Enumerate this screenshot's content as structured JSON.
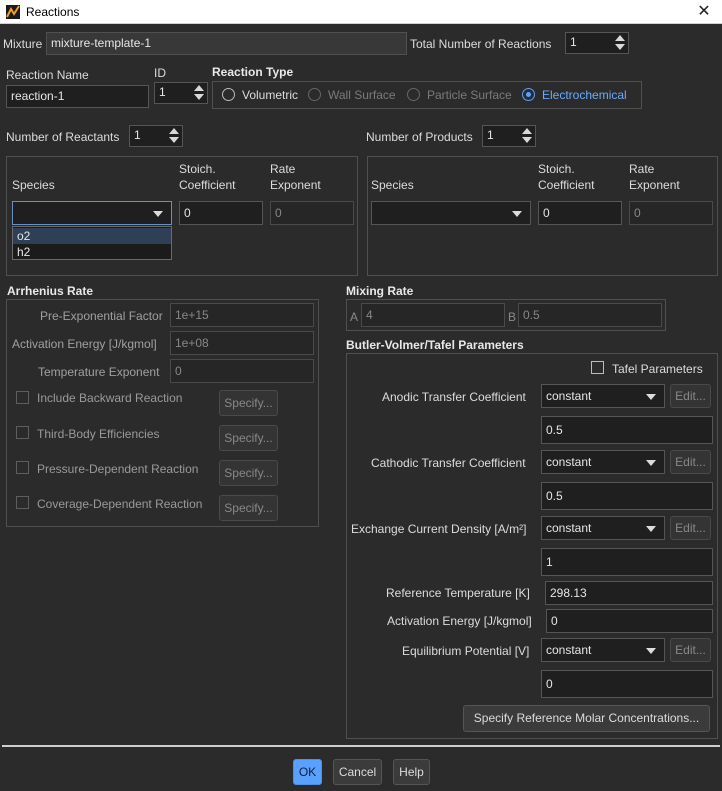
{
  "window": {
    "title": "Reactions",
    "close_glyph": "✕"
  },
  "mixture": {
    "label": "Mixture",
    "value": "mixture-template-1",
    "total_label": "Total Number of Reactions",
    "total_value": "1"
  },
  "reaction": {
    "name_label": "Reaction Name",
    "name_value": "reaction-1",
    "id_label": "ID",
    "id_value": "1",
    "type_label": "Reaction Type",
    "types": [
      "Volumetric",
      "Wall Surface",
      "Particle Surface",
      "Electrochemical"
    ],
    "selected_type": "Electrochemical"
  },
  "reactants": {
    "count_label": "Number of Reactants",
    "count_value": "1",
    "species_label": "Species",
    "stoich_label_1": "Stoich.",
    "stoich_label_2": "Coefficient",
    "rate_label_1": "Rate",
    "rate_label_2": "Exponent",
    "species_value": "",
    "stoich_value": "0",
    "rate_value": "0",
    "dropdown_options": [
      "o2",
      "h2"
    ]
  },
  "products": {
    "count_label": "Number of Products",
    "count_value": "1",
    "species_label": "Species",
    "stoich_label_1": "Stoich.",
    "stoich_label_2": "Coefficient",
    "rate_label_1": "Rate",
    "rate_label_2": "Exponent",
    "species_value": "",
    "stoich_value": "0",
    "rate_value": "0"
  },
  "arrhenius": {
    "title": "Arrhenius Rate",
    "pre_exp_label": "Pre-Exponential Factor",
    "pre_exp_value": "1e+15",
    "act_energy_label": "Activation Energy [J/kgmol]",
    "act_energy_value": "1e+08",
    "temp_exp_label": "Temperature Exponent",
    "temp_exp_value": "0",
    "options": [
      {
        "label": "Include Backward Reaction",
        "button": "Specify..."
      },
      {
        "label": "Third-Body Efficiencies",
        "button": "Specify..."
      },
      {
        "label": "Pressure-Dependent Reaction",
        "button": "Specify..."
      },
      {
        "label": "Coverage-Dependent Reaction",
        "button": "Specify..."
      }
    ]
  },
  "mixing": {
    "title": "Mixing Rate",
    "a_label": "A",
    "a_value": "4",
    "b_label": "B",
    "b_value": "0.5"
  },
  "butler_volmer": {
    "title": "Butler-Volmer/Tafel Parameters",
    "tafel_label": "Tafel Parameters",
    "anodic_label": "Anodic Transfer Coefficient",
    "anodic_method": "constant",
    "anodic_value": "0.5",
    "cathodic_label": "Cathodic Transfer Coefficient",
    "cathodic_method": "constant",
    "cathodic_value": "0.5",
    "exchange_label": "Exchange Current Density [A/m²]",
    "exchange_method": "constant",
    "exchange_value": "1",
    "ref_temp_label": "Reference Temperature [K]",
    "ref_temp_value": "298.13",
    "act_energy_label": "Activation Energy [J/kgmol]",
    "act_energy_value": "0",
    "equil_label": "Equilibrium Potential [V]",
    "equil_method": "constant",
    "equil_value": "0",
    "edit_label": "Edit...",
    "ref_molar_button": "Specify Reference Molar Concentrations..."
  },
  "footer": {
    "ok": "OK",
    "cancel": "Cancel",
    "help": "Help"
  },
  "colors": {
    "accent": "#5aa0ff",
    "background": "#2b2b2b"
  }
}
